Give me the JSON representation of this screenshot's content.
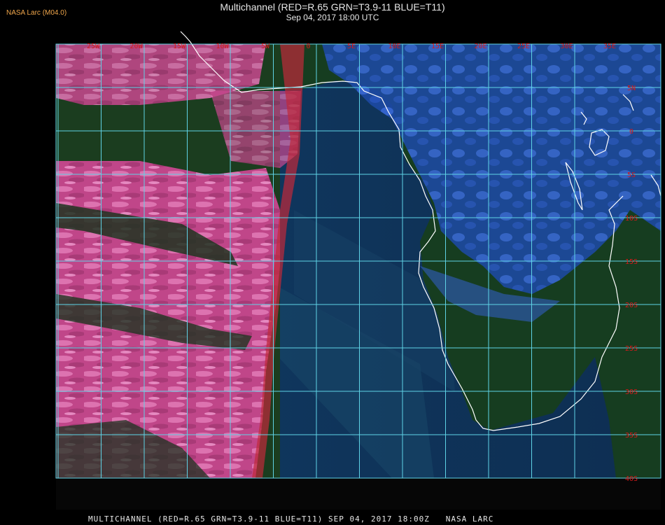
{
  "header": {
    "credit": "NASA Larc (M04.0)",
    "title": "Multichannel (RED=R.65 GRN=T3.9-11 BLUE=T11)",
    "subtitle": "Sep 04, 2017 18:00 UTC"
  },
  "footer": {
    "text": "MULTICHANNEL (RED=R.65 GRN=T3.9-11 BLUE=T11) SEP 04, 2017 18:00Z   NASA LARC"
  },
  "grid": {
    "longitude_labels": [
      "25W",
      "20W",
      "15W",
      "10W",
      "5W",
      "0",
      "5E",
      "10E",
      "15E",
      "20E",
      "25E",
      "30E",
      "35E"
    ],
    "latitude_labels": [
      "5N",
      "0",
      "5S",
      "10S",
      "15S",
      "20S",
      "25S",
      "30S",
      "35S",
      "40S"
    ]
  },
  "colors": {
    "grid": "#5fd3e6",
    "label": "#d81a1a",
    "coastline": "#ffffff",
    "land": "#143a1c",
    "ocean": "#0f2a4a",
    "cloud_low": "#e05aa6",
    "cloud_high": "#3a66e0"
  }
}
